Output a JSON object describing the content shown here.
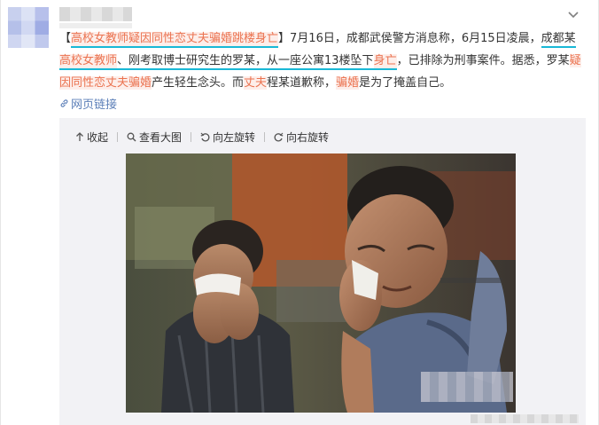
{
  "post": {
    "segments": [
      {
        "text": "【",
        "style": "plain"
      },
      {
        "text": "高校女教师疑因同性恋丈夫骗婚跳楼身亡",
        "style": "red-ul"
      },
      {
        "text": "】7月16日，成都武侯警方消息称，6月15日凌晨，",
        "style": "plain"
      },
      {
        "text": "成都某",
        "style": "ul"
      },
      {
        "text": "高校女教师",
        "style": "red-ul"
      },
      {
        "text": "、刚考取博士研究生的罗某，从一座公寓13楼坠下",
        "style": "ul"
      },
      {
        "text": "身亡",
        "style": "red-ul"
      },
      {
        "text": "，已排除为刑事案件。据悉，罗某",
        "style": "plain"
      },
      {
        "text": "疑因同性恋丈夫骗婚",
        "style": "red"
      },
      {
        "text": "产生轻生念头。而",
        "style": "plain"
      },
      {
        "text": "丈夫",
        "style": "red"
      },
      {
        "text": "程某道歉称，",
        "style": "plain"
      },
      {
        "text": "骗婚",
        "style": "red"
      },
      {
        "text": "是为了掩盖自己。",
        "style": "plain"
      }
    ],
    "web_link_label": "网页链接"
  },
  "media_toolbar": {
    "collapse_label": "收起",
    "view_large_label": "查看大图",
    "rotate_left_label": "向左旋转",
    "rotate_right_label": "向右旋转"
  },
  "icons": {
    "chevron": "chevron-down-icon",
    "link": "link-icon",
    "collapse": "arrow-up-icon",
    "zoom": "magnifier-icon",
    "rotate_left": "rotate-left-icon",
    "rotate_right": "rotate-right-icon"
  },
  "colors": {
    "highlight_text": "#eb7350",
    "underline_annotation": "#19b8d6",
    "link_blue": "#5c7fb8",
    "media_bg": "#f2f2f5"
  }
}
